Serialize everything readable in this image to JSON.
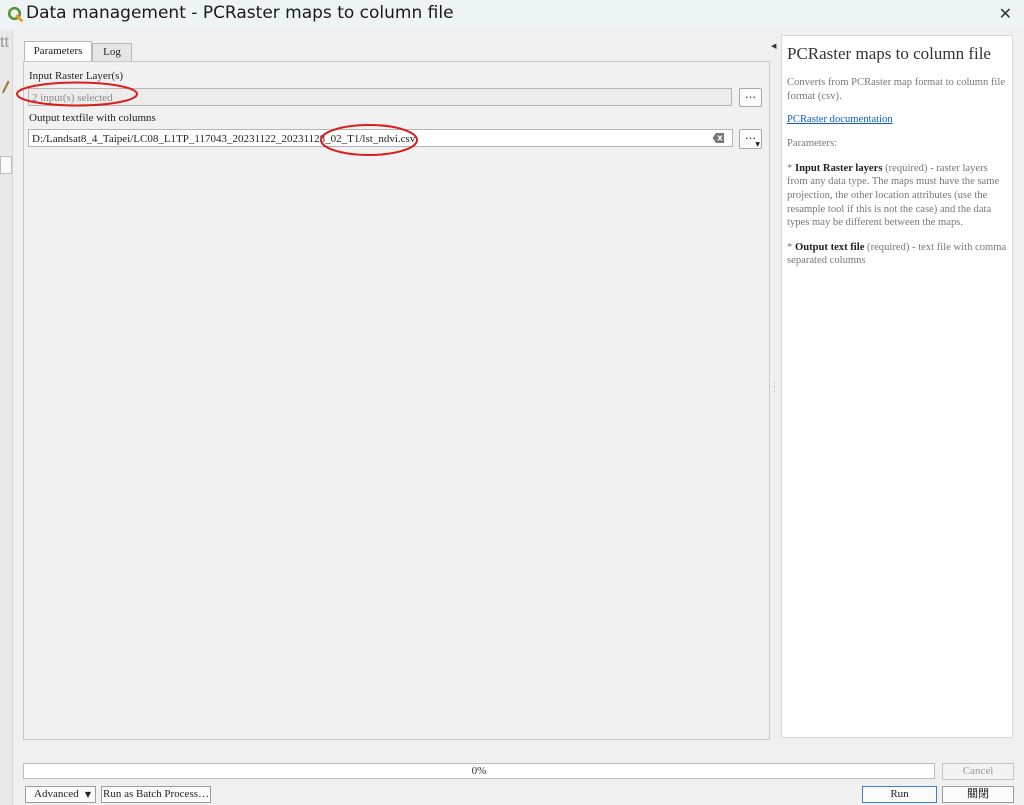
{
  "window": {
    "title": "Data management - PCRaster maps to column file",
    "close_glyph": "✕"
  },
  "background_app": {
    "fragment_text": "tt"
  },
  "tabs": [
    {
      "label": "Parameters",
      "active": true
    },
    {
      "label": "Log",
      "active": false
    }
  ],
  "params": {
    "input_raster": {
      "label": "Input Raster Layer(s)",
      "value": "2 input(s) selected",
      "browse_label": "…"
    },
    "output_file": {
      "label": "Output textfile with columns",
      "value": "D:/Landsat8_4_Taipei/LC08_L1TP_117043_20231122_20231128_02_T1/lst_ndvi.csv",
      "browse_label": "…"
    }
  },
  "help": {
    "title": "PCRaster maps to column file",
    "description": "Converts from PCRaster map format to column file format (csv).",
    "doc_link": "PCRaster documentation",
    "params_heading": "Parameters:",
    "param1_bullet": "* ",
    "param1_name": "Input Raster layers",
    "param1_text": " (required) - raster layers from any data type. The maps must have the same projection, the other location attributes (use the resample tool if this is not the case) and the data types may be different between the maps.",
    "param2_bullet": "* ",
    "param2_name": "Output text file",
    "param2_text": " (required) - text file with comma separated columns"
  },
  "bottom": {
    "progress_text": "0%",
    "progress_value": 0,
    "cancel_label": "Cancel",
    "advanced_label": "Advanced",
    "batch_label": "Run as Batch Process…",
    "run_label": "Run",
    "close_label": "關閉"
  },
  "icons": {
    "app": "qgis-icon",
    "close": "close-icon",
    "clear": "clear-text-icon",
    "dropdown": "chevron-down-icon",
    "collapse": "collapse-arrow-icon"
  },
  "colors": {
    "qgis_green": "#589632",
    "annotation_red": "#d81e1e",
    "link_blue": "#0a5fbf",
    "run_border": "#3f7fd0"
  }
}
